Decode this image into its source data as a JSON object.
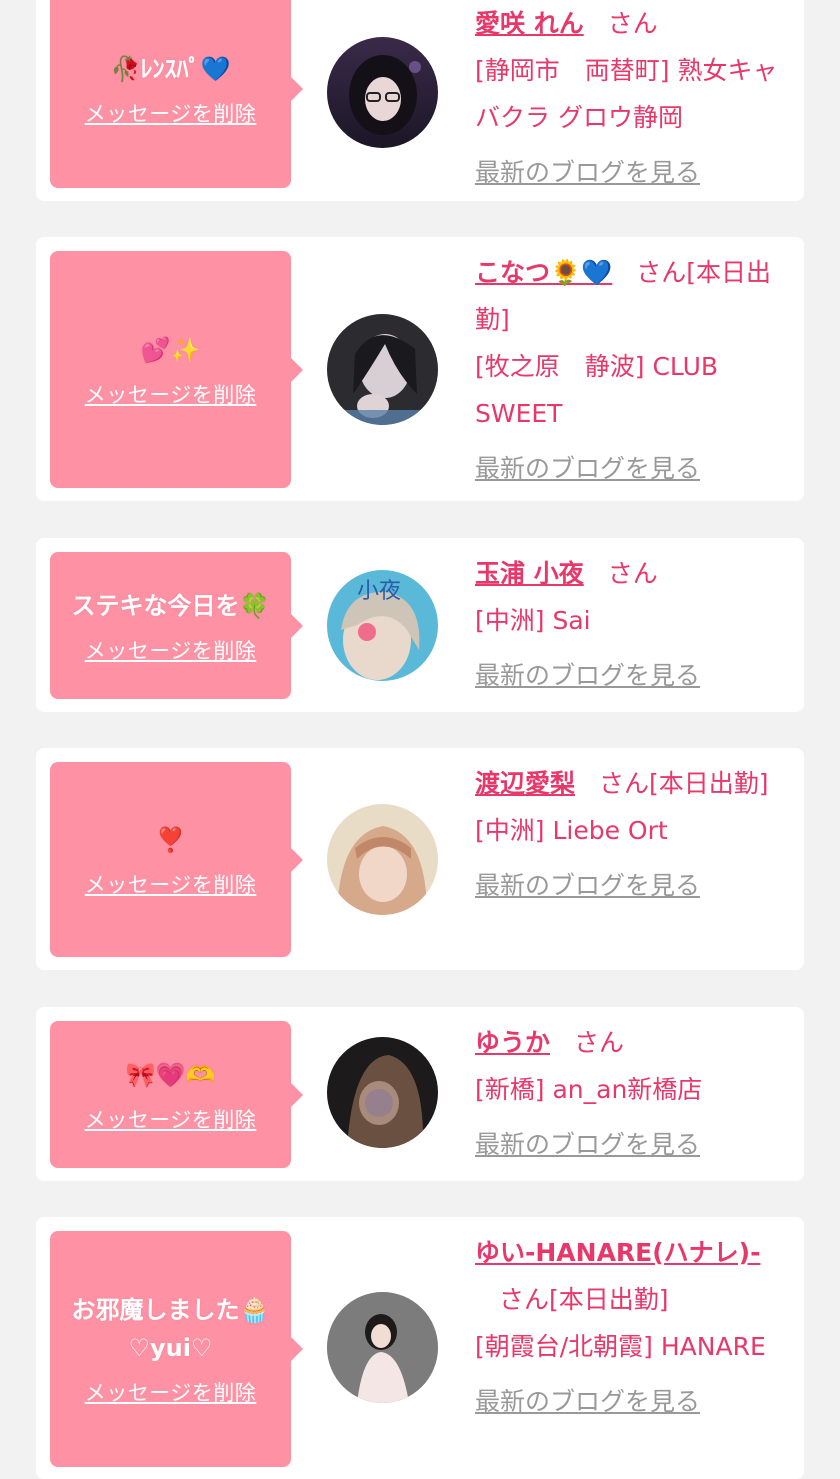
{
  "common": {
    "delete_label": "メッセージを削除",
    "blog_link": "最新のブログを見る",
    "san": "さん"
  },
  "messages": [
    {
      "message": "🥀ﾚﾝｽﾊﾟ💙",
      "name": "愛咲 れん",
      "after_san": "",
      "location": "[静岡市　両替町] 熟女キャバクラ グロウ静岡"
    },
    {
      "message": "💕✨",
      "name": "こなつ🌻💙",
      "after_san": "[本日出勤]",
      "location": "[牧之原　静波] CLUB SWEET"
    },
    {
      "message": "ステキな今日を🍀",
      "name": "玉浦 小夜",
      "after_san": "",
      "location": "[中洲] Sai"
    },
    {
      "message": "❣️",
      "name": "渡辺愛梨",
      "after_san": "[本日出勤]",
      "location": "[中洲] Liebe Ort"
    },
    {
      "message": "🎀💗🫶",
      "name": "ゆうか",
      "after_san": "",
      "location": "[新橋] an_an新橋店"
    },
    {
      "message": "お邪魔しました🧁",
      "message_line2": "♡yui♡",
      "name": "ゆい-HANARE(ハナレ)-",
      "after_san": "[本日出勤]",
      "location": "[朝霞台/北朝霞] HANARE"
    }
  ]
}
